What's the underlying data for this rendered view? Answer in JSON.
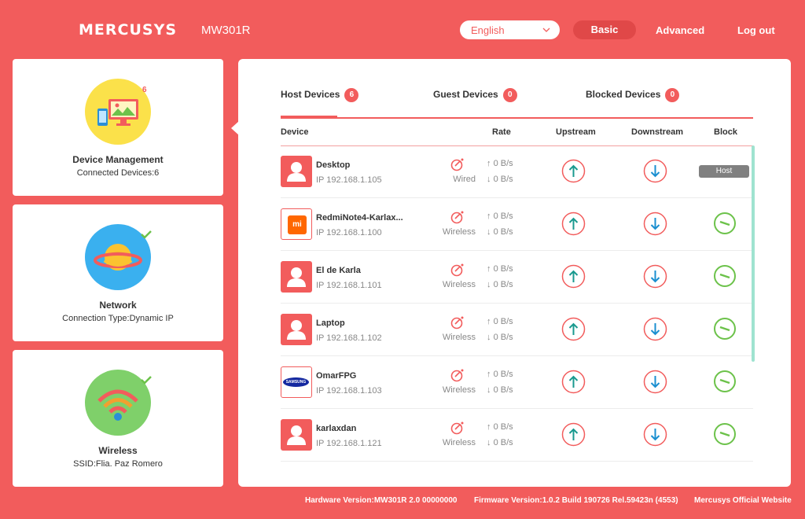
{
  "header": {
    "logo": "MERCUSYS",
    "model": "MW301R",
    "language": "English",
    "basic_label": "Basic",
    "advanced_label": "Advanced",
    "logout_label": "Log out"
  },
  "sidebar": {
    "device_management": {
      "title": "Device Management",
      "subtitle": "Connected Devices:6",
      "badge": "6"
    },
    "network": {
      "title": "Network",
      "subtitle": "Connection Type:Dynamic IP"
    },
    "wireless": {
      "title": "Wireless",
      "subtitle": "SSID:Flia. Paz Romero"
    }
  },
  "tabs": [
    {
      "label": "Host Devices",
      "count": "6"
    },
    {
      "label": "Guest Devices",
      "count": "0"
    },
    {
      "label": "Blocked Devices",
      "count": "0"
    }
  ],
  "columns": {
    "device": "Device",
    "rate": "Rate",
    "upstream": "Upstream",
    "downstream": "Downstream",
    "block": "Block"
  },
  "devices": [
    {
      "name": "Desktop",
      "ip": "IP 192.168.1.105",
      "connection": "Wired",
      "up_rate": "0 B/s",
      "down_rate": "0 B/s",
      "host_label": "Host",
      "icon": "person-icon"
    },
    {
      "name": "RedmiNote4-Karlax...",
      "ip": "IP 192.168.1.100",
      "connection": "Wireless",
      "up_rate": "0 B/s",
      "down_rate": "0 B/s",
      "icon": "xiaomi-logo",
      "logo_text": "mi"
    },
    {
      "name": "El de Karla",
      "ip": "IP 192.168.1.101",
      "connection": "Wireless",
      "up_rate": "0 B/s",
      "down_rate": "0 B/s",
      "icon": "person-icon"
    },
    {
      "name": "Laptop",
      "ip": "IP 192.168.1.102",
      "connection": "Wireless",
      "up_rate": "0 B/s",
      "down_rate": "0 B/s",
      "icon": "person-icon"
    },
    {
      "name": "OmarFPG",
      "ip": "IP 192.168.1.103",
      "connection": "Wireless",
      "up_rate": "0 B/s",
      "down_rate": "0 B/s",
      "icon": "samsung-logo",
      "logo_text": "SAMSUNG"
    },
    {
      "name": "karlaxdan",
      "ip": "IP 192.168.1.121",
      "connection": "Wireless",
      "up_rate": "0 B/s",
      "down_rate": "0 B/s",
      "icon": "person-icon"
    }
  ],
  "footer": {
    "hardware": "Hardware Version:MW301R 2.0 00000000",
    "firmware": "Firmware Version:1.0.2 Build 190726 Rel.59423n (4553)",
    "website": "Mercusys Official Website"
  },
  "colors": {
    "accent": "#f25c5c",
    "green": "#6cc24a",
    "teal": "#1a9a8f",
    "blue": "#1a8fd0"
  }
}
